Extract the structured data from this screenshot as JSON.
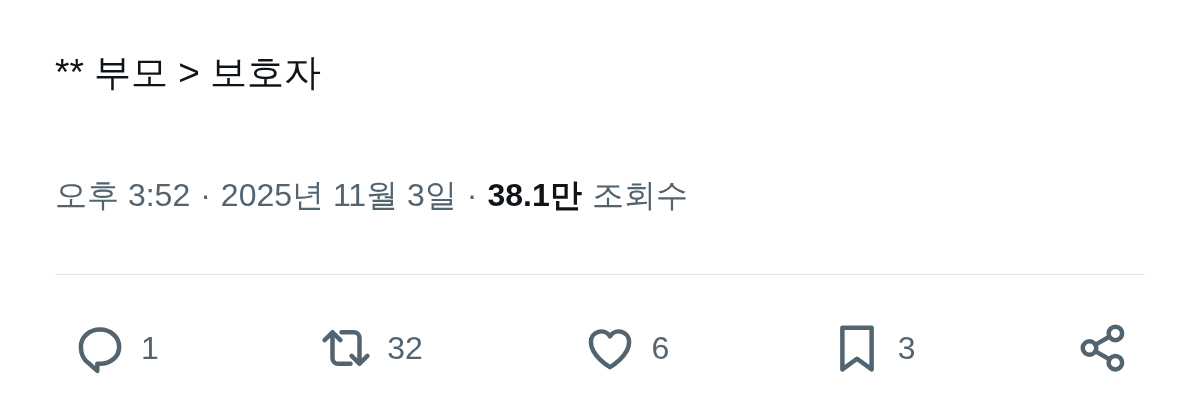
{
  "tweet": {
    "text": "** 부모 > 보호자"
  },
  "meta": {
    "time": "오후 3:52",
    "separator_1": "·",
    "date": "2025년 11월 3일",
    "separator_2": "·",
    "views_count": "38.1만",
    "views_label": "조회수"
  },
  "actions": [
    {
      "kind": "reply",
      "count": "1"
    },
    {
      "kind": "repost",
      "count": "32"
    },
    {
      "kind": "like",
      "count": "6"
    },
    {
      "kind": "bookmark",
      "count": "3"
    },
    {
      "kind": "share"
    }
  ]
}
